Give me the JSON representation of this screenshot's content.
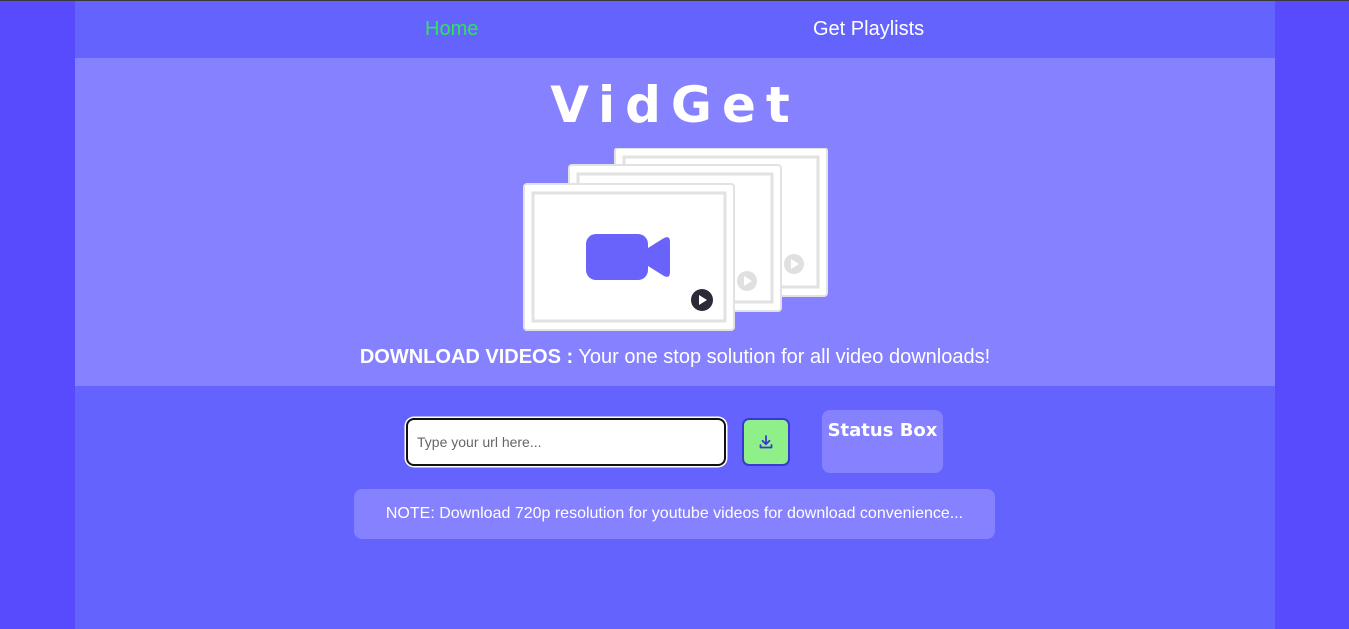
{
  "nav": {
    "home_label": "Home",
    "playlists_label": "Get Playlists"
  },
  "hero": {
    "brand": "VidGet",
    "tagline_strong": "DOWNLOAD VIDEOS :",
    "tagline_rest": " Your one stop solution for all video downloads!",
    "illustration_icon": "video-camera-icon"
  },
  "form": {
    "url_placeholder": "Type your url here...",
    "url_value": "",
    "download_icon": "download-icon"
  },
  "status": {
    "title": "Status Box"
  },
  "note": {
    "text": "NOTE: Download 720p resolution for youtube videos for download convenience..."
  },
  "colors": {
    "background": "#574bfd",
    "panel": "#6563fe",
    "hero": "#8681fe",
    "nav_active": "#2fe35a",
    "download_button": "#8ff08a",
    "camera": "#6a63fb"
  }
}
